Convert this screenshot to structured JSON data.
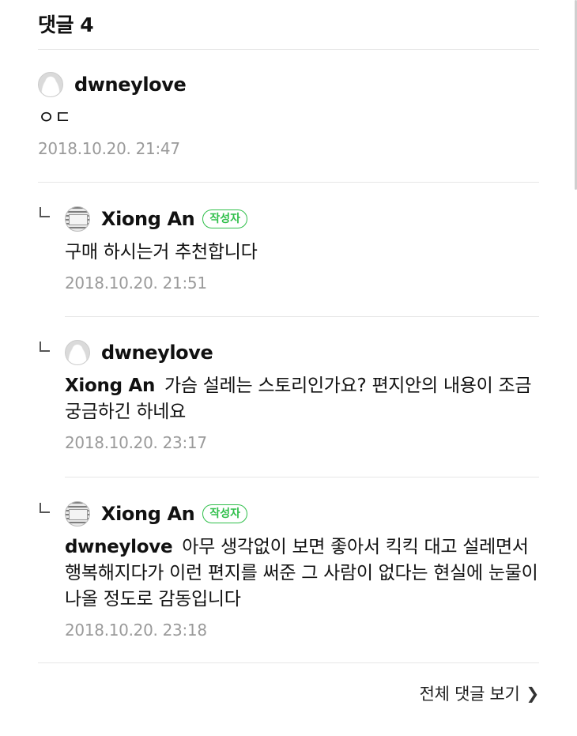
{
  "header": {
    "title": "댓글 4"
  },
  "comments": [
    {
      "author": "dwneylove",
      "badge": "",
      "mention": "",
      "text": "ㅇㄷ",
      "date": "2018.10.20. 21:47"
    },
    {
      "author": "Xiong An",
      "badge": "작성자",
      "mention": "",
      "text": "구매 하시는거 추천합니다",
      "date": "2018.10.20. 21:51"
    },
    {
      "author": "dwneylove",
      "badge": "",
      "mention": "Xiong An",
      "text": "가슴 설레는 스토리인가요? 편지안의 내용이 조금 궁금하긴 하네요",
      "date": "2018.10.20. 23:17"
    },
    {
      "author": "Xiong An",
      "badge": "작성자",
      "mention": "dwneylove",
      "text": "아무 생각없이 보면 좋아서 킥킥 대고 설레면서 행복해지다가 이런 편지를 써준 그 사람이 없다는 현실에 눈물이 나올 정도로 감동입니다",
      "date": "2018.10.20. 23:18"
    }
  ],
  "footer": {
    "view_all": "전체 댓글 보기",
    "chevron_icon": "chevron-right-icon"
  },
  "colors": {
    "badge_green": "#2fbf4a",
    "date_gray": "#9a9a9a",
    "divider": "#e6e6e6"
  }
}
